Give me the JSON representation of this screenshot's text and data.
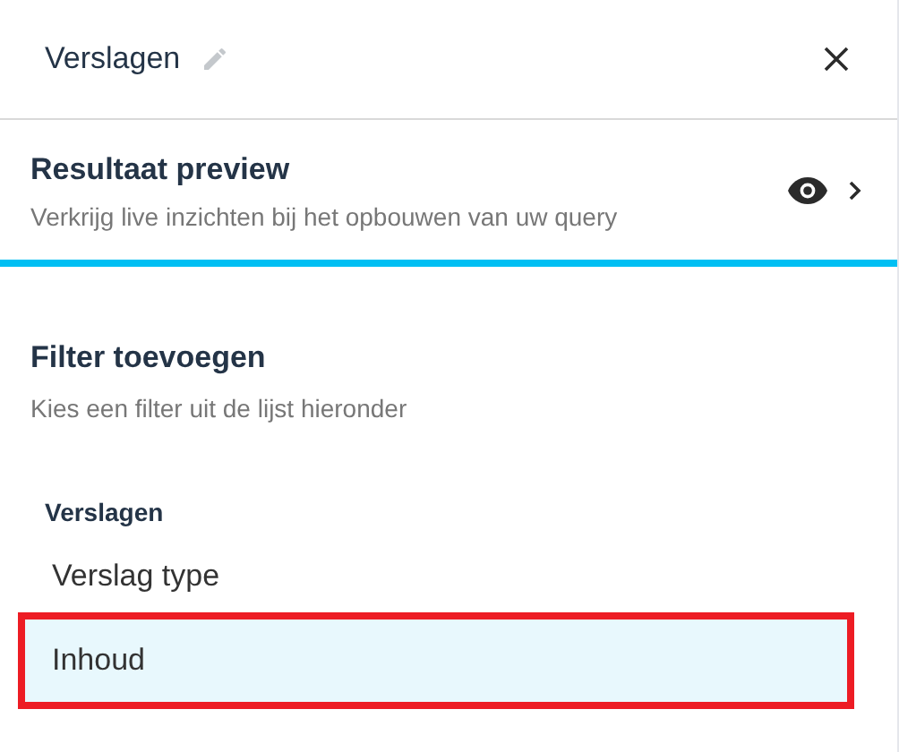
{
  "header": {
    "title": "Verslagen"
  },
  "preview": {
    "title": "Resultaat preview",
    "subtitle": "Verkrijg live inzichten bij het opbouwen van uw query"
  },
  "filter": {
    "title": "Filter toevoegen",
    "subtitle": "Kies een filter uit de lijst hieronder",
    "groups": [
      {
        "label": "Verslagen",
        "items": [
          {
            "label": "Verslag type",
            "selected": false,
            "highlighted": false
          },
          {
            "label": "Inhoud",
            "selected": true,
            "highlighted": true
          }
        ]
      }
    ]
  }
}
